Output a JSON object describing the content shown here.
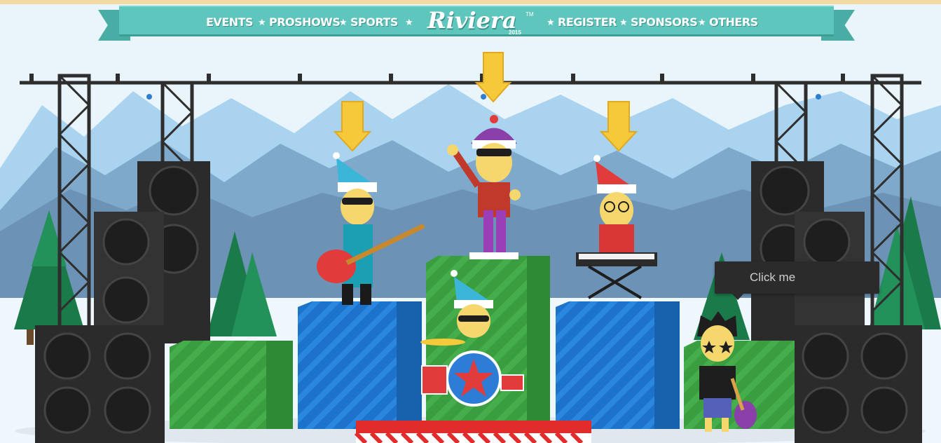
{
  "nav": {
    "items_left": [
      "EVENTS",
      "PROSHOWS",
      "SPORTS"
    ],
    "items_right": [
      "REGISTER",
      "SPONSORS",
      "OTHERS"
    ],
    "logo_text": "Riviera",
    "logo_year": "2015",
    "logo_tm": "TM"
  },
  "tooltip": {
    "label": "Click me"
  },
  "colors": {
    "sky": "#e9f5fb",
    "nav": "#5fc6bd",
    "gift_blue": "#1c73c9",
    "gift_green": "#3a9d3f",
    "speaker": "#2b2b2b",
    "arrow": "#f5c93a"
  },
  "icons": [
    "star-icon",
    "down-arrow-icon",
    "drum-star-icon",
    "guitar-icon"
  ]
}
